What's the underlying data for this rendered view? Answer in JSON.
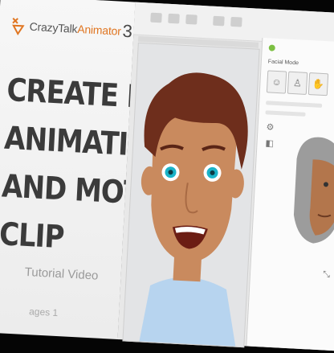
{
  "promo": {
    "logo_text_main": "CrazyTalk",
    "logo_text_accent": "Animator",
    "logo_version": "3",
    "title_lines": [
      "CREATE FACIAL",
      "ANIMATION",
      "AND MOTION",
      "CLIP"
    ],
    "subtitle": "Tutorial Video",
    "footer": "ages 1"
  },
  "app": {
    "panel": {
      "header": "Facial Mode",
      "close_icon": "close-icon",
      "mode_icons": [
        "face-mode-icon",
        "body-mode-icon",
        "puppet-mode-icon"
      ],
      "side_icons": [
        "wrench-icon",
        "lock-icon"
      ]
    }
  },
  "colors": {
    "background": "#050505",
    "brand_accent": "#e07622",
    "title_text": "#3b3b3b",
    "eye": "#1ab3c8",
    "hair": "#6e2e1c",
    "skin": "#c98a5e",
    "shirt": "#b7d4ef",
    "status_dot": "#7cc043"
  }
}
